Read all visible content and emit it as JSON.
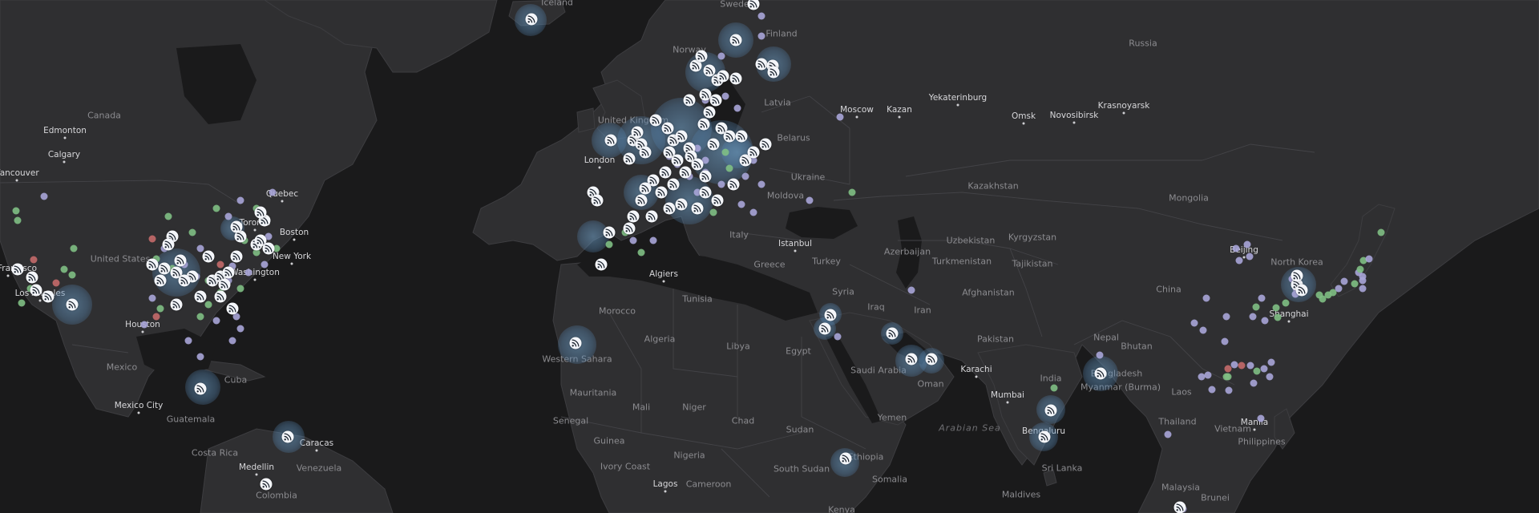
{
  "map": {
    "colors": {
      "ocean": "#1a1a1b",
      "land": "#2f2f31",
      "border": "#434347",
      "halo": "#6b9ec8",
      "pin": "#f4f6fa",
      "dot_blue": "#a9a5d8",
      "dot_green": "#7fbf84",
      "dot_red": "#c46a6a"
    },
    "icons": {
      "pin": "rss-feed-icon"
    },
    "labels": {
      "countries": [
        "Canada",
        "United States",
        "Mexico",
        "Cuba",
        "Venezuela",
        "Colombia",
        "Costa Rica",
        "Guatemala",
        "Morocco",
        "Western Sahara",
        "Algeria",
        "Tunisia",
        "Libya",
        "Egypt",
        "Mauritania",
        "Mali",
        "Niger",
        "Chad",
        "Sudan",
        "South Sudan",
        "Nigeria",
        "Cameroon",
        "Ivory Coast",
        "Senegal",
        "Guinea",
        "Somalia",
        "Kenya",
        "Ethiopia",
        "Yemen",
        "Oman",
        "Saudi Arabia",
        "Iraq",
        "Iran",
        "Syria",
        "Turkey",
        "Greece",
        "Italy",
        "Ukraine",
        "Belarus",
        "Latvia",
        "Finland",
        "Sweden",
        "Norway",
        "United Kingdom",
        "Iceland",
        "Russia",
        "Kazakhstan",
        "Uzbekistan",
        "Turkmenistan",
        "Kyrgyzstan",
        "Tajikistan",
        "Azerbaijan",
        "Moldova",
        "Afghanistan",
        "Pakistan",
        "Nepal",
        "Bhutan",
        "India",
        "Bangladesh",
        "Myanmar (Burma)",
        "Sri Lanka",
        "Maldives",
        "China",
        "Mongolia",
        "North Korea",
        "Laos",
        "Thailand",
        "Vietnam",
        "Malaysia",
        "Brunei",
        "Philippines"
      ],
      "cities": [
        "Edmonton",
        "Calgary",
        "Vancouver",
        "Quebec",
        "Toronto",
        "Boston",
        "New York",
        "Washington",
        "Los Angeles",
        "San Francisco",
        "Houston",
        "Mexico City",
        "Caracas",
        "Medellin",
        "London",
        "Algiers",
        "Istanbul",
        "Moscow",
        "Kazan",
        "Yekaterinburg",
        "Omsk",
        "Novosibirsk",
        "Krasnoyarsk",
        "Karachi",
        "Mumbai",
        "Bengaluru",
        "Beijing",
        "Shanghai",
        "Manila",
        "Lagos"
      ],
      "seas": [
        "Arabian Sea"
      ]
    }
  }
}
